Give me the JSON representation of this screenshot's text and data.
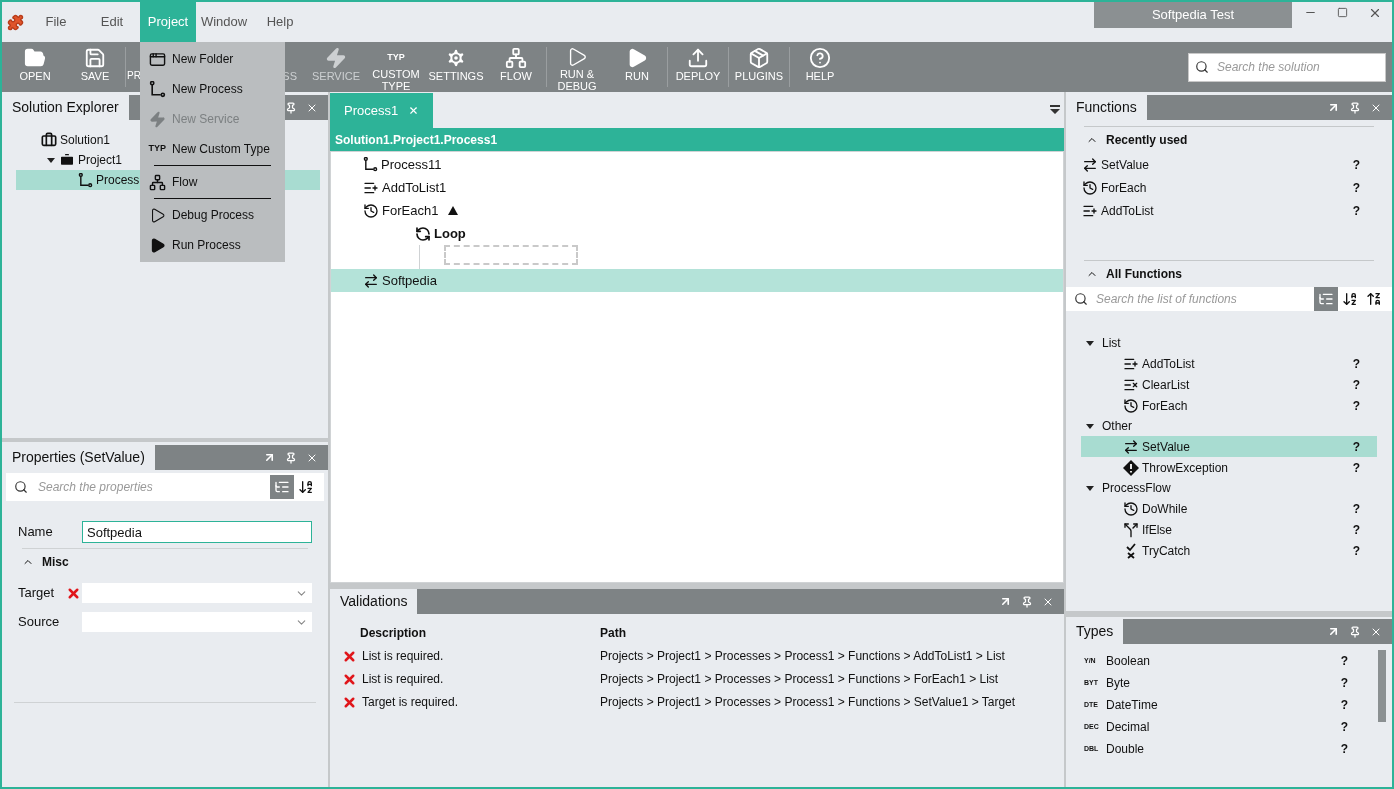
{
  "window": {
    "title": "Softpedia Test"
  },
  "menu": [
    {
      "label": "File",
      "selected": false
    },
    {
      "label": "Edit",
      "selected": false
    },
    {
      "label": "Project",
      "selected": true
    },
    {
      "label": "Window",
      "selected": false
    },
    {
      "label": "Help",
      "selected": false
    }
  ],
  "project_menu": {
    "sections": [
      [
        {
          "kind": "folder",
          "label": "New Folder",
          "disabled": false
        },
        {
          "kind": "process",
          "label": "New Process",
          "disabled": false
        },
        {
          "kind": "service",
          "label": "New Service",
          "disabled": true
        },
        {
          "kind": "type",
          "badge": "TYP",
          "label": "New Custom Type",
          "disabled": false
        }
      ],
      [
        {
          "kind": "flow",
          "label": "Flow",
          "disabled": false
        }
      ],
      [
        {
          "kind": "debug",
          "label": "Debug Process",
          "disabled": false
        },
        {
          "kind": "run",
          "label": "Run Process",
          "disabled": false
        }
      ]
    ]
  },
  "toolbar_groups": [
    [
      {
        "kind": "open",
        "label": "OPEN",
        "disabled": false
      },
      {
        "kind": "save",
        "label": "SAVE",
        "disabled": false
      }
    ],
    [
      {
        "kind": "project",
        "label": "PR",
        "disabled": false
      },
      {
        "kind": "process",
        "label": "SS",
        "disabled": true
      },
      {
        "kind": "service",
        "label": "SERVICE",
        "disabled": true
      },
      {
        "kind": "type",
        "badge": "TYP",
        "label": "CUSTOM TYPE",
        "disabled": false
      },
      {
        "kind": "settings",
        "label": "SETTINGS",
        "disabled": false
      },
      {
        "kind": "flow",
        "label": "FLOW",
        "disabled": false
      }
    ],
    [
      {
        "kind": "debug",
        "label": "RUN & DEBUG",
        "disabled": false
      },
      {
        "kind": "run",
        "label": "RUN",
        "disabled": false
      }
    ],
    [
      {
        "kind": "deploy",
        "label": "DEPLOY",
        "disabled": false
      }
    ],
    [
      {
        "kind": "plugins",
        "label": "PLUGINS",
        "disabled": false
      }
    ],
    [
      {
        "kind": "help",
        "label": "HELP",
        "disabled": false
      }
    ]
  ],
  "search": {
    "placeholder": "Search the solution"
  },
  "solution_explorer": {
    "title": "Solution Explorer",
    "tree": [
      {
        "kind": "solution",
        "label": "Solution1",
        "selected": false,
        "children": [
          {
            "kind": "project",
            "label": "Project1",
            "selected": false,
            "expanded": true,
            "children": [
              {
                "kind": "process",
                "label": "Process",
                "selected": true
              }
            ]
          }
        ]
      }
    ]
  },
  "properties": {
    "title": "Properties (SetValue)",
    "search_placeholder": "Search the properties",
    "view_buttons": [
      {
        "kind": "categorized",
        "selected": true
      },
      {
        "kind": "alphabetical",
        "selected": false
      }
    ],
    "name": {
      "label": "Name",
      "value": "Softpedia"
    },
    "section": {
      "label": "Misc",
      "expanded": true
    },
    "fields": [
      {
        "label": "Target",
        "error": true
      },
      {
        "label": "Source",
        "error": false
      }
    ]
  },
  "editor": {
    "tabs": [
      {
        "label": "Process1",
        "selected": true
      }
    ],
    "path": "Solution1.Project1.Process1",
    "nodes": [
      {
        "kind": "process",
        "label": "Process11",
        "selected": false
      },
      {
        "kind": "addtolist",
        "label": "AddToList1",
        "selected": false
      },
      {
        "kind": "foreach",
        "label": "ForEach1",
        "selected": false,
        "expanded": true,
        "children": [
          {
            "kind": "loop",
            "label": "Loop",
            "selected": false
          }
        ]
      },
      {
        "kind": "setvalue",
        "label": "Softpedia",
        "selected": true
      }
    ]
  },
  "validations": {
    "title": "Validations",
    "columns": [
      "Description",
      "Path"
    ],
    "rows": [
      {
        "kind": "error",
        "description": "List is required.",
        "path": "Projects > Project1 > Processes > Process1 > Functions > AddToList1 > List"
      },
      {
        "kind": "error",
        "description": "List is required.",
        "path": "Projects > Project1 > Processes > Process1 > Functions > ForEach1 > List"
      },
      {
        "kind": "error",
        "description": "Target is required.",
        "path": "Projects > Project1 > Processes > Process1 > Functions > SetValue1 > Target"
      }
    ]
  },
  "functions": {
    "title": "Functions",
    "recent": {
      "label": "Recently used",
      "expanded": true,
      "items": [
        {
          "kind": "setvalue",
          "label": "SetValue",
          "help": "?"
        },
        {
          "kind": "foreach",
          "label": "ForEach",
          "help": "?"
        },
        {
          "kind": "addtolist",
          "label": "AddToList",
          "help": "?"
        }
      ]
    },
    "all": {
      "label": "All Functions",
      "expanded": true,
      "search_placeholder": "Search the list of functions",
      "view_buttons": [
        {
          "kind": "categorized",
          "selected": true
        },
        {
          "kind": "az",
          "selected": false
        },
        {
          "kind": "za",
          "selected": false
        }
      ],
      "groups": [
        {
          "label": "List",
          "expanded": true,
          "children": [
            {
              "kind": "addtolist",
              "label": "AddToList",
              "help": "?",
              "selected": false
            },
            {
              "kind": "clearlist",
              "label": "ClearList",
              "help": "?",
              "selected": false
            },
            {
              "kind": "foreach",
              "label": "ForEach",
              "help": "?",
              "selected": false
            }
          ]
        },
        {
          "label": "Other",
          "expanded": true,
          "children": [
            {
              "kind": "setvalue",
              "label": "SetValue",
              "help": "?",
              "selected": true
            },
            {
              "kind": "throwexception",
              "label": "ThrowException",
              "help": "?",
              "selected": false
            }
          ]
        },
        {
          "label": "ProcessFlow",
          "expanded": true,
          "children": [
            {
              "kind": "dowhile",
              "label": "DoWhile",
              "help": "?",
              "selected": false
            },
            {
              "kind": "ifelse",
              "label": "IfElse",
              "help": "?",
              "selected": false
            },
            {
              "kind": "trycatch",
              "label": "TryCatch",
              "help": "?",
              "selected": false
            }
          ]
        }
      ]
    }
  },
  "types": {
    "title": "Types",
    "items": [
      {
        "badge": "Y/N",
        "label": "Boolean",
        "help": "?"
      },
      {
        "badge": "BYT",
        "label": "Byte",
        "help": "?"
      },
      {
        "badge": "DTE",
        "label": "DateTime",
        "help": "?"
      },
      {
        "badge": "DEC",
        "label": "Decimal",
        "help": "?"
      },
      {
        "badge": "DBL",
        "label": "Double",
        "help": "?"
      }
    ]
  }
}
